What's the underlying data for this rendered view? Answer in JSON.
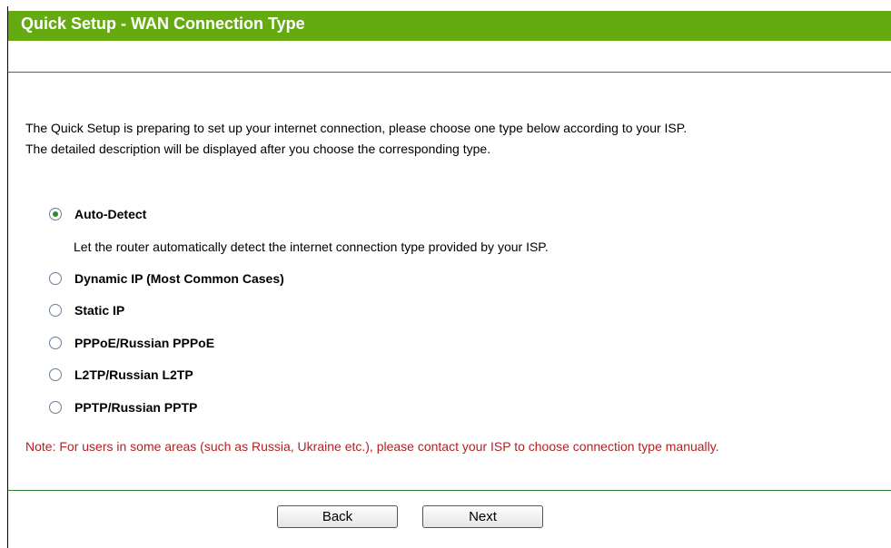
{
  "header": {
    "title": "Quick Setup - WAN Connection Type"
  },
  "intro": {
    "line1": "The Quick Setup is preparing to set up your internet connection, please choose one type below according to your ISP.",
    "line2": "The detailed description will be displayed after you choose the corresponding type."
  },
  "options": [
    {
      "label": "Auto-Detect",
      "selected": true
    },
    {
      "label": "Dynamic IP (Most Common Cases)",
      "selected": false
    },
    {
      "label": "Static IP",
      "selected": false
    },
    {
      "label": "PPPoE/Russian PPPoE",
      "selected": false
    },
    {
      "label": "L2TP/Russian L2TP",
      "selected": false
    },
    {
      "label": "PPTP/Russian PPTP",
      "selected": false
    }
  ],
  "auto_detect_description": "Let the router automatically detect the internet connection type provided by your ISP.",
  "note": "Note: For users in some areas (such as Russia, Ukraine etc.), please contact your ISP to choose connection type manually.",
  "buttons": {
    "back": "Back",
    "next": "Next"
  },
  "colors": {
    "title_bar": "#66aa11",
    "note_text": "#b22222",
    "divider": "#2e7d32"
  }
}
